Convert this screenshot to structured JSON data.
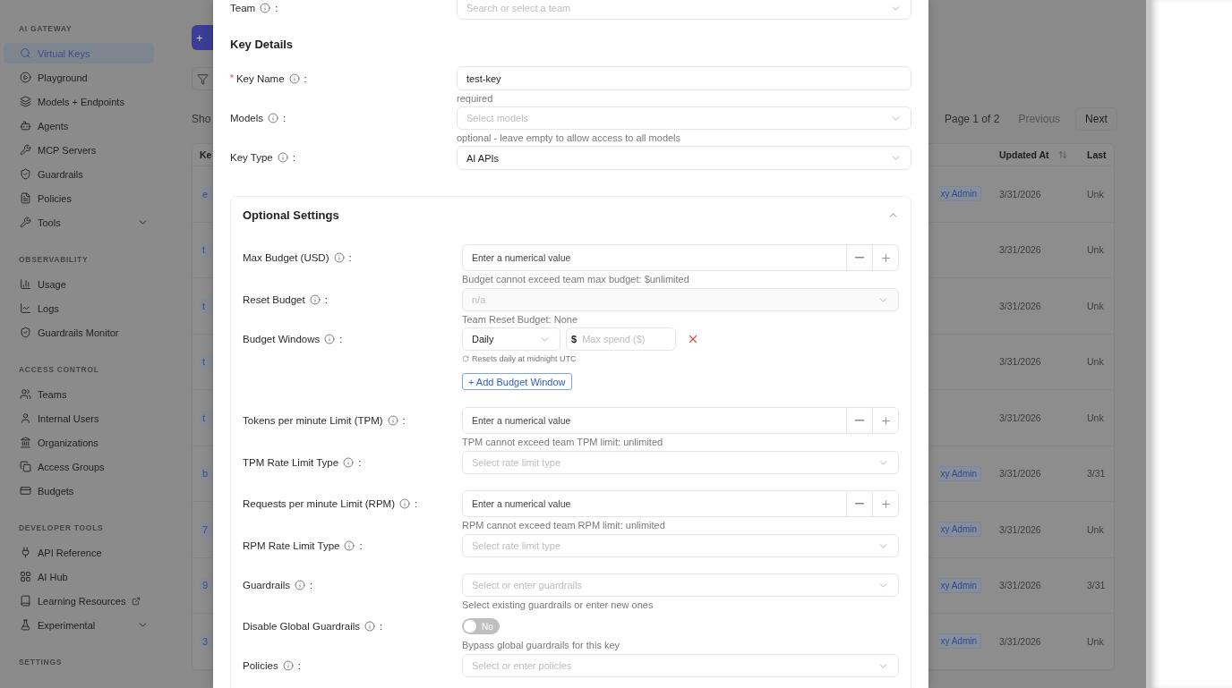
{
  "sidebar": {
    "sections": [
      {
        "title": "AI GATEWAY",
        "items": [
          {
            "label": "Virtual Keys",
            "selected": true,
            "kind": "link"
          },
          {
            "label": "Playground",
            "selected": false,
            "kind": "link"
          },
          {
            "label": "Models + Endpoints",
            "selected": false,
            "kind": "link"
          },
          {
            "label": "Agents",
            "selected": false,
            "kind": "link"
          },
          {
            "label": "MCP Servers",
            "selected": false,
            "kind": "link"
          },
          {
            "label": "Guardrails",
            "selected": false,
            "kind": "link"
          },
          {
            "label": "Policies",
            "selected": false,
            "kind": "link"
          },
          {
            "label": "Tools",
            "selected": false,
            "kind": "group"
          }
        ]
      },
      {
        "title": "OBSERVABILITY",
        "items": [
          {
            "label": "Usage",
            "selected": false,
            "kind": "link"
          },
          {
            "label": "Logs",
            "selected": false,
            "kind": "link"
          },
          {
            "label": "Guardrails Monitor",
            "selected": false,
            "kind": "link"
          }
        ]
      },
      {
        "title": "ACCESS CONTROL",
        "items": [
          {
            "label": "Teams",
            "selected": false,
            "kind": "link"
          },
          {
            "label": "Internal Users",
            "selected": false,
            "kind": "link"
          },
          {
            "label": "Organizations",
            "selected": false,
            "kind": "link"
          },
          {
            "label": "Access Groups",
            "selected": false,
            "kind": "link"
          },
          {
            "label": "Budgets",
            "selected": false,
            "kind": "link"
          }
        ]
      },
      {
        "title": "DEVELOPER TOOLS",
        "items": [
          {
            "label": "API Reference",
            "selected": false,
            "kind": "link"
          },
          {
            "label": "AI Hub",
            "selected": false,
            "kind": "link"
          },
          {
            "label": "Learning Resources",
            "selected": false,
            "kind": "external"
          },
          {
            "label": "Experimental",
            "selected": false,
            "kind": "group"
          }
        ]
      },
      {
        "title": "SETTINGS"
      }
    ]
  },
  "background_page": {
    "create_button": "+",
    "show_label": "Sho",
    "pagination": {
      "page": "Page 1 of 2",
      "previous": {
        "label": "Previous",
        "disabled": true
      },
      "next": {
        "label": "Next",
        "disabled": false
      }
    },
    "table": {
      "columns": [
        {
          "label": "Ke"
        },
        {
          "label": "Updated At",
          "sortable": true
        },
        {
          "label": "Last"
        }
      ],
      "rows": [
        {
          "key": "e",
          "badge": "xy Admin",
          "updated_at": "3/31/2026",
          "last": "Unk"
        },
        {
          "key": "t",
          "updated_at": "3/31/2026",
          "last": "Unk"
        },
        {
          "key": "t",
          "updated_at": "3/31/2026",
          "last": "Unk"
        },
        {
          "key": "t",
          "updated_at": "3/31/2026",
          "last": "Unk"
        },
        {
          "key": "t",
          "updated_at": "3/31/2026",
          "last": "Unk"
        },
        {
          "key": "b",
          "badge": "xy Admin",
          "updated_at": "3/31/2026",
          "last": "3/31"
        },
        {
          "key": "7",
          "badge": "xy Admin",
          "updated_at": "3/31/2026",
          "last": "Unk"
        },
        {
          "key": "9",
          "badge": "xy Admin",
          "updated_at": "3/31/2026",
          "last": "3/31"
        },
        {
          "key": "3",
          "badge": "xy Admin",
          "updated_at": "3/31/2026",
          "last": "Unk"
        }
      ]
    }
  },
  "modal": {
    "top_fields": [
      {
        "kind": "select",
        "label": "Team",
        "colon": ":",
        "placeholder": "Search or select a team"
      }
    ],
    "section_title": "Key Details",
    "fields": [
      {
        "kind": "text",
        "label": "Key Name",
        "required_mark": "*",
        "colon": ":",
        "value": "test-key",
        "help": "required"
      },
      {
        "kind": "select",
        "label": "Models",
        "colon": ":",
        "placeholder": "Select models",
        "help": "optional - leave empty to allow access to all models"
      },
      {
        "kind": "select",
        "label": "Key Type",
        "colon": ":",
        "value": "AI APIs"
      }
    ],
    "optional_settings": {
      "title": "Optional Settings",
      "expanded": true,
      "fields": [
        {
          "kind": "number",
          "label": "Max Budget (USD)",
          "colon": ":",
          "placeholder": "Enter a numerical value",
          "help": "Budget cannot exceed team max budget: $unlimited"
        },
        {
          "kind": "select",
          "label": "Reset Budget",
          "colon": ":",
          "value": "n/a",
          "disabled": true,
          "help": "Team Reset Budget: None"
        },
        {
          "kind": "budget_windows",
          "label": "Budget Windows",
          "colon": ":",
          "windows": [
            {
              "period": "Daily",
              "currency": "$",
              "placeholder": "Max spend ($)",
              "hint": "Resets daily at midnight UTC"
            }
          ],
          "add_button": "+ Add Budget Window"
        },
        {
          "kind": "number",
          "label": "Tokens per minute Limit (TPM)",
          "colon": ":",
          "placeholder": "Enter a numerical value",
          "help": "TPM cannot exceed team TPM limit: unlimited"
        },
        {
          "kind": "select",
          "label": "TPM Rate Limit Type",
          "colon": ":",
          "placeholder": "Select rate limit type",
          "disabled": false
        },
        {
          "kind": "number",
          "label": "Requests per minute Limit (RPM)",
          "colon": ":",
          "placeholder": "Enter a numerical value",
          "help": "RPM cannot exceed team RPM limit: unlimited"
        },
        {
          "kind": "select",
          "label": "RPM Rate Limit Type",
          "colon": ":",
          "placeholder": "Select rate limit type",
          "disabled": false
        },
        {
          "kind": "select",
          "label": "Guardrails",
          "colon": ":",
          "placeholder": "Select or enter guardrails",
          "disabled": false,
          "help": "Select existing guardrails or enter new ones"
        },
        {
          "kind": "switch",
          "label": "Disable Global Guardrails",
          "colon": ":",
          "on": false,
          "state_label": "No",
          "help": "Bypass global guardrails for this key"
        },
        {
          "kind": "select",
          "label": "Policies",
          "colon": ":",
          "placeholder": "Select or enter policies",
          "disabled": false
        }
      ]
    }
  }
}
